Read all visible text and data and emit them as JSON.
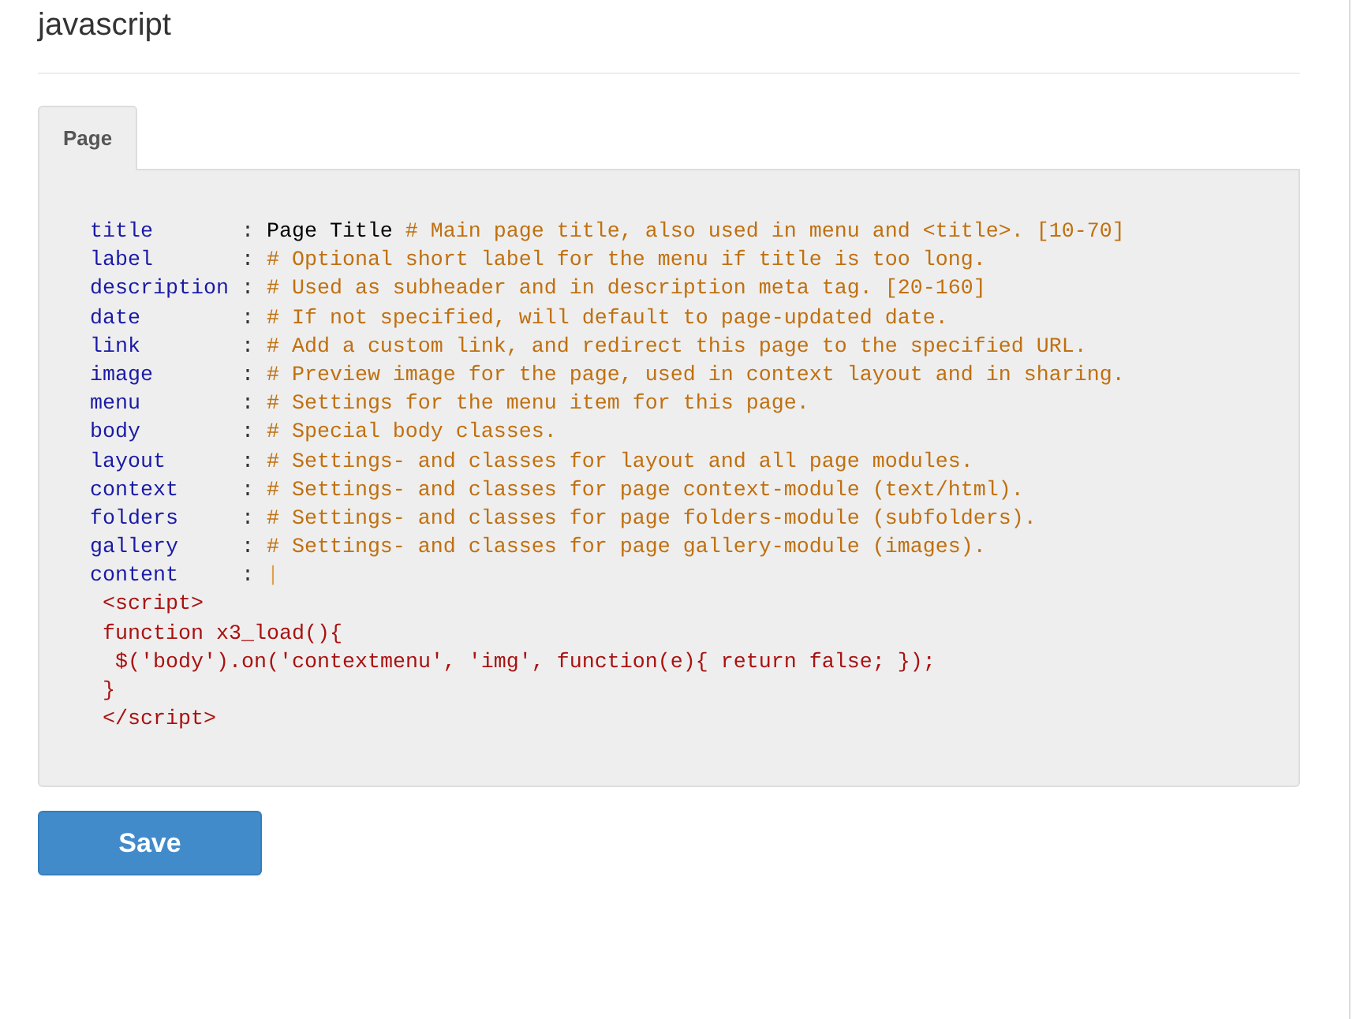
{
  "heading": "javascript",
  "tabs": [
    {
      "label": "Page",
      "selected": true
    }
  ],
  "editor": {
    "lines": [
      {
        "key": "title",
        "separator": ":",
        "value": "Page Title",
        "comment": "# Main page title, also used in menu and <title>. [10-70]"
      },
      {
        "key": "label",
        "separator": ":",
        "comment": "# Optional short label for the menu if title is too long."
      },
      {
        "key": "description",
        "separator": ":",
        "comment": "# Used as subheader and in description meta tag. [20-160]"
      },
      {
        "key": "date",
        "separator": ":",
        "comment": "# If not specified, will default to page-updated date."
      },
      {
        "key": "link",
        "separator": ":",
        "comment": "# Add a custom link, and redirect this page to the specified URL."
      },
      {
        "key": "image",
        "separator": ":",
        "comment": "# Preview image for the page, used in context layout and in sharing."
      },
      {
        "key": "menu",
        "separator": ":",
        "comment": "# Settings for the menu item for this page."
      },
      {
        "key": "body",
        "separator": ":",
        "comment": "# Special body classes."
      },
      {
        "key": "layout",
        "separator": ":",
        "comment": "# Settings- and classes for layout and all page modules."
      },
      {
        "key": "context",
        "separator": ":",
        "comment": "# Settings- and classes for page context-module (text/html)."
      },
      {
        "key": "folders",
        "separator": ":",
        "comment": "# Settings- and classes for page folders-module (subfolders)."
      },
      {
        "key": "gallery",
        "separator": ":",
        "comment": "# Settings- and classes for page gallery-module (images)."
      },
      {
        "key": "content",
        "separator": ":",
        "block": "|",
        "children": [
          {
            "text": "<script>"
          },
          {
            "text": "function x3_load(){",
            "children": [
              {
                "text": "$('body').on('contextmenu', 'img', function(e){ return false; });"
              }
            ]
          },
          {
            "text": "}"
          },
          {
            "text": "</script>"
          }
        ]
      }
    ]
  },
  "buttons": [
    {
      "label": "Save"
    }
  ]
}
